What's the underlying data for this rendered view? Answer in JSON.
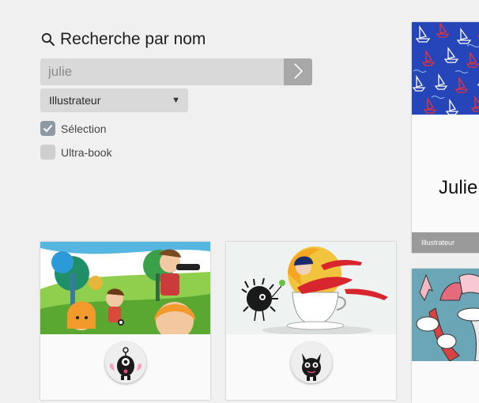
{
  "search": {
    "title": "Recherche par nom",
    "query": "julie",
    "placeholder": "julie",
    "submit_icon": "chevron-right-icon"
  },
  "filters": {
    "type_selected": "Illustrateur",
    "checkboxes": [
      {
        "label": "Sélection",
        "checked": true
      },
      {
        "label": "Ultra-book",
        "checked": false
      }
    ]
  },
  "featured": {
    "name": "Julie",
    "role": "Illustrateur"
  },
  "colors": {
    "input_bg": "#d9d9d9",
    "button_bg": "#a8a8a8",
    "checkbox_checked": "#8e9aa3",
    "role_bar": "#9a9a9a"
  }
}
